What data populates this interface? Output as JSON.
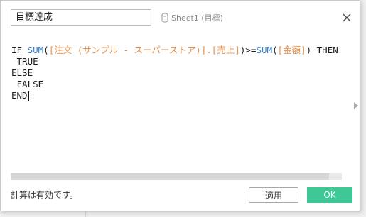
{
  "dialog": {
    "calc_name": "目標達成",
    "data_source": "Sheet1 (目標)",
    "data_source_icon": "database-icon",
    "close_icon": "close-icon"
  },
  "formula": {
    "line1": {
      "if": "IF ",
      "sum1": "SUM",
      "p1": "(",
      "field1": "[注文 (サンプル - スーパーストア)].[売上]",
      "mid": ")>=",
      "sum2": "SUM",
      "p2": "(",
      "field2": "[金額]",
      "then": ") THEN"
    },
    "line2": " TRUE",
    "line3": "ELSE",
    "line4": " FALSE",
    "line5": "END"
  },
  "footer": {
    "status": "計算は有効です。",
    "apply_label": "適用",
    "ok_label": "OK"
  },
  "colors": {
    "function": "#2f7fcf",
    "field": "#e6914b",
    "ok_button": "#3fc795"
  }
}
